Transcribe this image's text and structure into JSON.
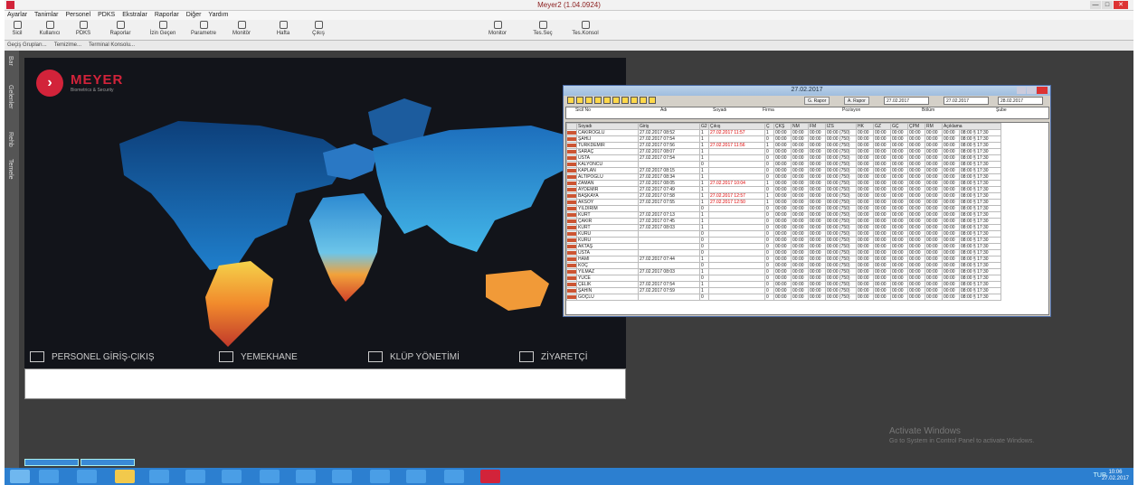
{
  "window": {
    "title": "Meyer2 (1.04.0924)"
  },
  "menu": [
    "Ayarlar",
    "Tanimlar",
    "Personel",
    "PDKS",
    "Ekstralar",
    "Raporlar",
    "Diğer",
    "Yardım"
  ],
  "toolbar": [
    "Sicil",
    "Kullanıcı",
    "PDKS",
    "Raporlar",
    "İzin Geçen",
    "Parametre",
    "Monitör",
    "Hafta",
    "Çıkış",
    "Monitor",
    "Tes.Seç",
    "Tes.Konsol"
  ],
  "subtoolbar": [
    "Geçiş Grupları...",
    "Temizlme...",
    "Terminal Konsolu..."
  ],
  "sidetabs": [
    "Bar",
    "Gelenler",
    "Rehb",
    "Temele"
  ],
  "brand": {
    "name": "MEYER",
    "tagline": "Biometrics & Security",
    "color": "#d2233a"
  },
  "nav": [
    "PERSONEL GİRİŞ-ÇIKIŞ",
    "YEMEKHANE",
    "KLÜP YÖNETİMİ",
    "ZİYARETÇİ"
  ],
  "watermark": {
    "title": "Activate Windows",
    "subtitle": "Go to System in Control Panel to activate Windows."
  },
  "clock": {
    "time": "10:06",
    "date": "27.02.2017"
  },
  "tray": "TUR",
  "dialog": {
    "title": "27.02.2017",
    "report_btn1": "G. Rapor",
    "report_btn2": "A. Rapor",
    "date_from": "27.02.2017",
    "date_to": "27.02.2017",
    "date_to2": "28.02.2017",
    "filter_labels": [
      "Sicil No",
      "Adı",
      "Soyadı",
      "Firma",
      "Pozisyon",
      "Bölüm",
      "Şube"
    ],
    "columns": [
      "Soyadı",
      "Giriş",
      "G2",
      "Çıkış",
      "Ç",
      "ÇKŞ",
      "NM",
      "FM",
      "İZS",
      "HK",
      "GZ",
      "GÇ",
      "ÇPM",
      "RM",
      "Açıklama"
    ],
    "rows": [
      [
        "CAKIROĞLU",
        "27.02.2017 08:52",
        "1",
        "27.02.2017 11:57",
        "1"
      ],
      [
        "ŞAHLI",
        "27.02.2017 07:54",
        "1",
        "",
        "0"
      ],
      [
        "TÜRKDEMİR",
        "27.02.2017 07:56",
        "1",
        "27.02.2017 11:56",
        "1"
      ],
      [
        "SARAÇ",
        "27.02.2017 08:07",
        "1",
        "",
        "0"
      ],
      [
        "USTA",
        "27.02.2017 07:54",
        "1",
        "",
        "0"
      ],
      [
        "KALYONCU",
        "",
        "0",
        "",
        "0"
      ],
      [
        "KAPLAN",
        "27.02.2017 08:15",
        "1",
        "",
        "0"
      ],
      [
        "ALTIPOĞLU",
        "27.02.2017 08:34",
        "1",
        "",
        "0"
      ],
      [
        "ZAMAN",
        "27.02.2017 08:05",
        "1",
        "27.02.2017 10:04",
        "1"
      ],
      [
        "AYDEMİR",
        "27.02.2017 07:49",
        "1",
        "",
        "0"
      ],
      [
        "BAŞKAYA",
        "27.02.2017 07:58",
        "1",
        "27.02.2017 12:57",
        "1"
      ],
      [
        "AKSOY",
        "27.02.2017 07:55",
        "1",
        "27.02.2017 12:50",
        "1"
      ],
      [
        "YILDIRIM",
        "",
        "0",
        "",
        "0"
      ],
      [
        "KURT",
        "27.02.2017 07:13",
        "1",
        "",
        "0"
      ],
      [
        "ÇAKIR",
        "27.02.2017 07:45",
        "1",
        "",
        "0"
      ],
      [
        "KURT",
        "27.02.2017 08:03",
        "1",
        "",
        "0"
      ],
      [
        "KURU",
        "",
        "0",
        "",
        "0"
      ],
      [
        "KURU",
        "",
        "0",
        "",
        "0"
      ],
      [
        "AKTAŞ",
        "",
        "0",
        "",
        "0"
      ],
      [
        "USTA",
        "",
        "0",
        "",
        "0"
      ],
      [
        "HAMI",
        "27.02.2017 07:44",
        "1",
        "",
        "0"
      ],
      [
        "KOÇ",
        "",
        "0",
        "",
        "0"
      ],
      [
        "YILMAZ",
        "27.02.2017 08:03",
        "1",
        "",
        "0"
      ],
      [
        "YÜCE",
        "",
        "0",
        "",
        "0"
      ],
      [
        "ÇELİK",
        "27.02.2017 07:54",
        "1",
        "",
        "0"
      ],
      [
        "ŞAHİN",
        "27.02.2017 07:59",
        "1",
        "",
        "0"
      ],
      [
        "GÖÇLÜ",
        "",
        "0",
        "",
        "0"
      ]
    ],
    "time_cells": [
      "00:00",
      "00:00",
      "00:00",
      "00:00 (750)",
      "00:00",
      "00:00",
      "00:00",
      "00:00",
      "00:00",
      "00:00",
      "08:00 § 17:30"
    ]
  }
}
